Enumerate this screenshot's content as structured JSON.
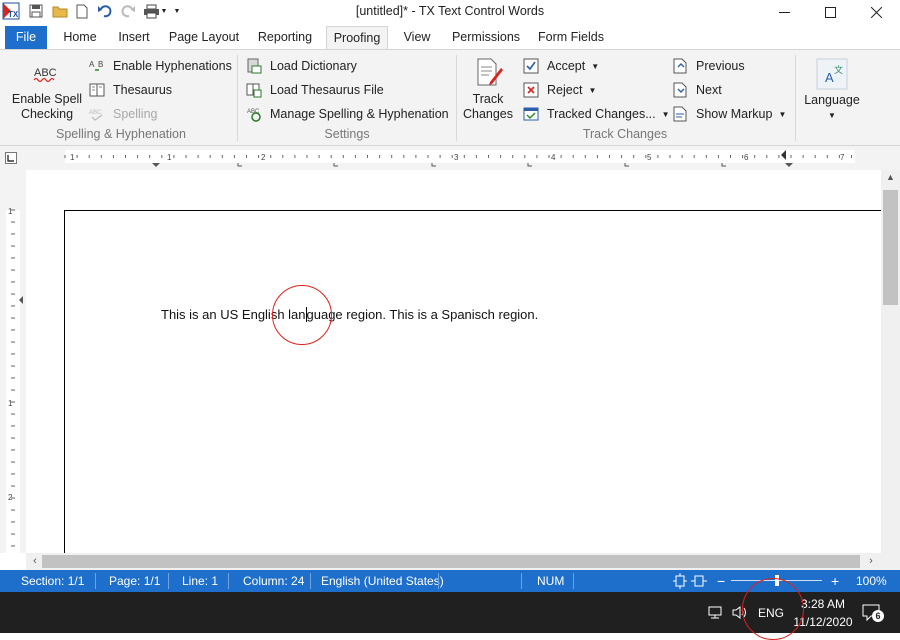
{
  "titlebar": {
    "title": "[untitled]* - TX Text Control Words",
    "app_icon_text": "TX"
  },
  "tabs": [
    "File",
    "Home",
    "Insert",
    "Page Layout",
    "Reporting",
    "Proofing",
    "View",
    "Permissions",
    "Form Fields"
  ],
  "active_tab": "Proofing",
  "ribbon": {
    "spelling_group": {
      "abc_icon_text": "ABC",
      "enable_spell_checking": [
        "Enable Spell",
        "Checking"
      ],
      "enable_hyphenations": "Enable Hyphenations",
      "thesaurus": "Thesaurus",
      "spelling": "Spelling",
      "label": "Spelling & Hyphenation"
    },
    "settings_group": {
      "load_dictionary": "Load Dictionary",
      "load_thesaurus_file": "Load Thesaurus File",
      "manage_spelling": "Manage Spelling & Hyphenation",
      "label": "Settings"
    },
    "track_group": {
      "track_changes": [
        "Track",
        "Changes"
      ],
      "accept": "Accept",
      "reject": "Reject",
      "tracked_changes": "Tracked Changes...",
      "previous": "Previous",
      "next": "Next",
      "show_markup": "Show Markup",
      "label": "Track Changes"
    },
    "language_group": {
      "language": "Language"
    }
  },
  "ruler": {
    "h_numbers": [
      "1",
      "1",
      "2",
      "3",
      "4",
      "5",
      "6",
      "7"
    ],
    "v_numbers": [
      "1",
      "1",
      "2"
    ]
  },
  "document": {
    "text_before_cursor": "This is an US English lan",
    "text_after_cursor": "guage region. This is a Spanisch region."
  },
  "statusbar": {
    "section": "Section: 1/1",
    "page": "Page: 1/1",
    "line": "Line: 1",
    "column": "Column: 24",
    "language": "English (United States)",
    "num": "NUM",
    "zoom": "100%",
    "zoom_fraction": 0.5
  },
  "taskbar": {
    "input_language": "ENG",
    "time": "3:28 AM",
    "date": "11/12/2020",
    "notification_count": "6"
  }
}
